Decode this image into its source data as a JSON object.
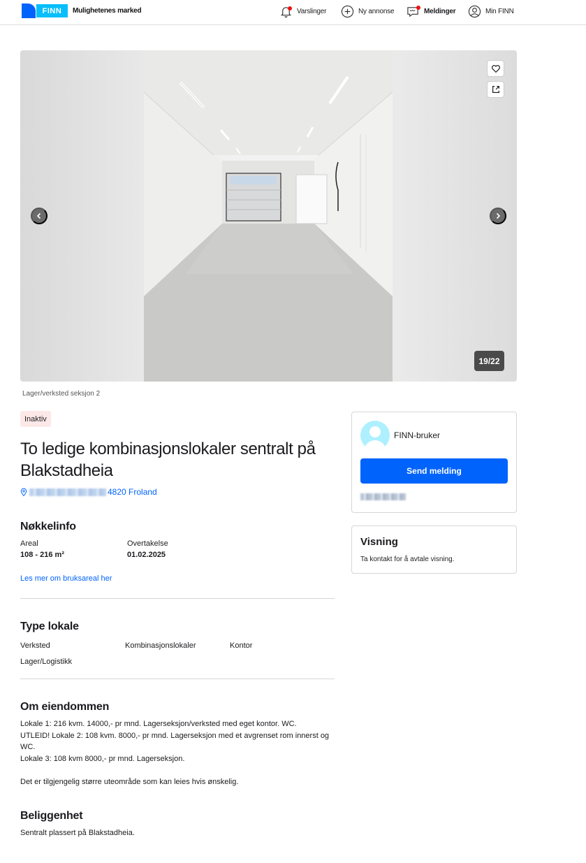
{
  "header": {
    "logo_text": "FINN",
    "tagline": "Mulighetenes marked",
    "nav": {
      "alerts": "Varslinger",
      "new_ad": "Ny annonse",
      "messages": "Meldinger",
      "my_finn": "Min FINN"
    },
    "colors": {
      "brand_blue": "#0063fb",
      "logo_cyan": "#06befb",
      "notification_dot": "#ee1111"
    }
  },
  "gallery": {
    "counter": "19/22",
    "caption": "Lager/verksted seksjon 2"
  },
  "listing": {
    "status_badge": "Inaktiv",
    "title": "To ledige kombinasjonslokaler sentralt på Blakstadheia",
    "address_suffix": "4820 Froland",
    "key_info": {
      "heading": "Nøkkelinfo",
      "area_label": "Areal",
      "area_value": "108 - 216 m²",
      "takeover_label": "Overtakelse",
      "takeover_value": "01.02.2025",
      "more_link": "Les mer om bruksareal her"
    },
    "type": {
      "heading": "Type lokale",
      "items": [
        "Verksted",
        "Kombinasjonslokaler",
        "Kontor",
        "Lager/Logistikk"
      ]
    },
    "property": {
      "heading": "Om eiendommen",
      "lines": [
        "Lokale 1: 216 kvm. 14000,- pr mnd. Lagerseksjon/verksted med eget kontor. WC.",
        "UTLEID! Lokale 2: 108 kvm.  8000,- pr mnd. Lagerseksjon med et avgrenset rom innerst og WC.",
        "Lokale 3: 108 kvm 8000,- pr mnd. Lagerseksjon."
      ],
      "extra": "Det er tilgjengelig større uteområde som kan leies hvis ønskelig."
    },
    "location": {
      "heading": "Beliggenhet",
      "text": "Sentralt plassert på Blakstadheia."
    }
  },
  "seller": {
    "name": "FINN-bruker",
    "send_button": "Send melding"
  },
  "viewing": {
    "heading": "Visning",
    "text": "Ta kontakt for å avtale visning."
  }
}
